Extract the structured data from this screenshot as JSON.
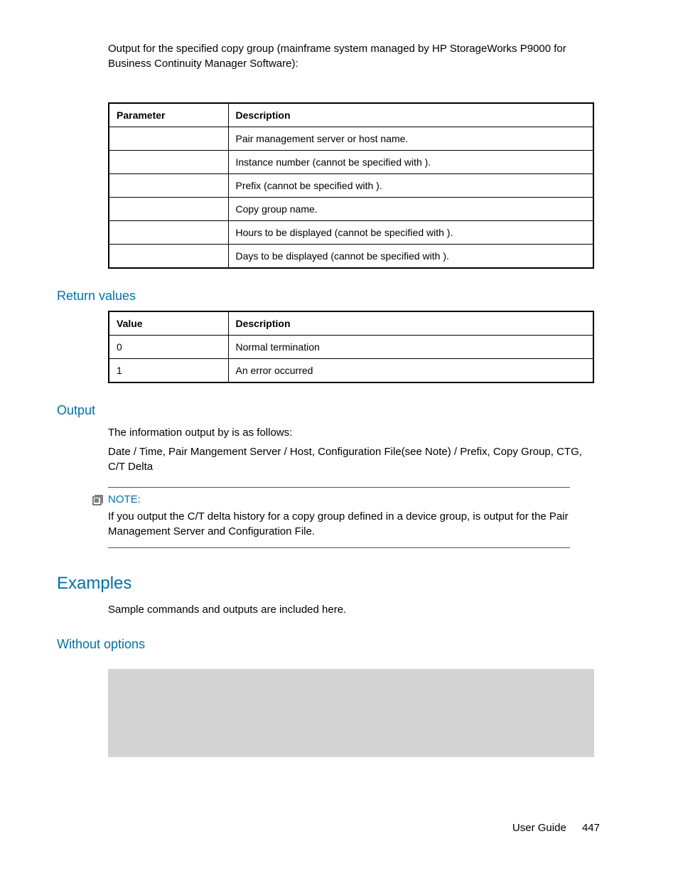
{
  "intro_text": "Output for the specified copy group (mainframe system managed by HP StorageWorks P9000 for Business Continuity Manager Software):",
  "param_table": {
    "headers": [
      "Parameter",
      "Description"
    ],
    "rows": [
      [
        "",
        "Pair management server or host name."
      ],
      [
        "",
        "Instance number (cannot be specified with                )."
      ],
      [
        "",
        "Prefix (cannot be specified with                              )."
      ],
      [
        "",
        "Copy group name."
      ],
      [
        "",
        "Hours to be displayed (cannot be specified with         )."
      ],
      [
        "",
        "Days to be displayed (cannot be specified with           )."
      ]
    ]
  },
  "sections": {
    "return_values": "Return values",
    "output": "Output",
    "examples": "Examples",
    "without_options": "Without options"
  },
  "return_table": {
    "headers": [
      "Value",
      "Description"
    ],
    "rows": [
      [
        "0",
        "Normal termination"
      ],
      [
        "1",
        "An error occurred"
      ]
    ]
  },
  "output_text1": "The information output by                     is as follows:",
  "output_text2": "Date / Time, Pair Mangement Server / Host, Configuration File(see Note) / Prefix, Copy Group, CTG, C/T Delta",
  "note": {
    "label": "NOTE:",
    "text": "If you output the C/T delta history for a copy group defined in a device group,        is output for the Pair Management Server and Configuration File."
  },
  "examples_text": "Sample commands and outputs are included here.",
  "footer": {
    "label": "User Guide",
    "page": "447"
  }
}
